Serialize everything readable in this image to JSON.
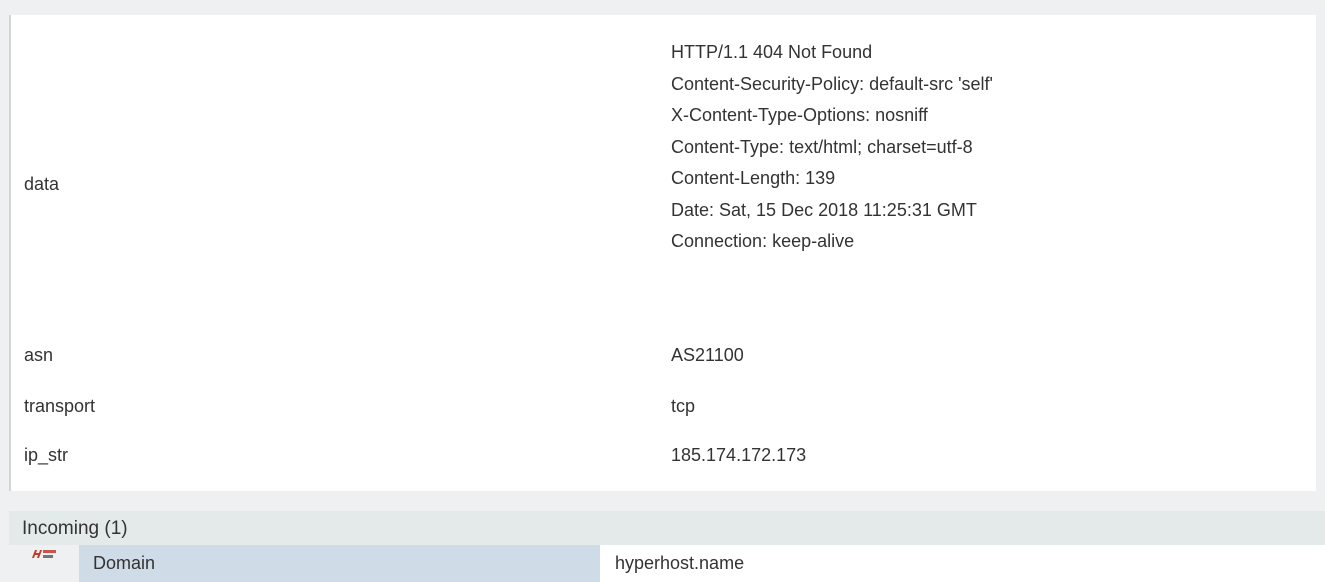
{
  "details": {
    "data": {
      "key": "data",
      "lines": [
        "HTTP/1.1 404 Not Found",
        "Content-Security-Policy: default-src 'self'",
        "X-Content-Type-Options: nosniff",
        "Content-Type: text/html; charset=utf-8",
        "Content-Length: 139",
        "Date: Sat, 15 Dec 2018 11:25:31 GMT",
        "Connection: keep-alive"
      ]
    },
    "asn": {
      "key": "asn",
      "value": "AS21100"
    },
    "transport": {
      "key": "transport",
      "value": "tcp"
    },
    "ip_str": {
      "key": "ip_str",
      "value": "185.174.172.173"
    }
  },
  "incoming": {
    "title": "Incoming (1)",
    "rows": [
      {
        "icon": "hyperhost-logo-icon",
        "label": "Domain",
        "value": "hyperhost.name"
      }
    ]
  },
  "colors": {
    "page_background": "#eef0f1",
    "panel_background": "#ffffff",
    "incoming_header_background": "#e4eaea",
    "domain_label_background": "#cfdbe6",
    "text": "#333333",
    "logo_accent": "#c0392b"
  }
}
